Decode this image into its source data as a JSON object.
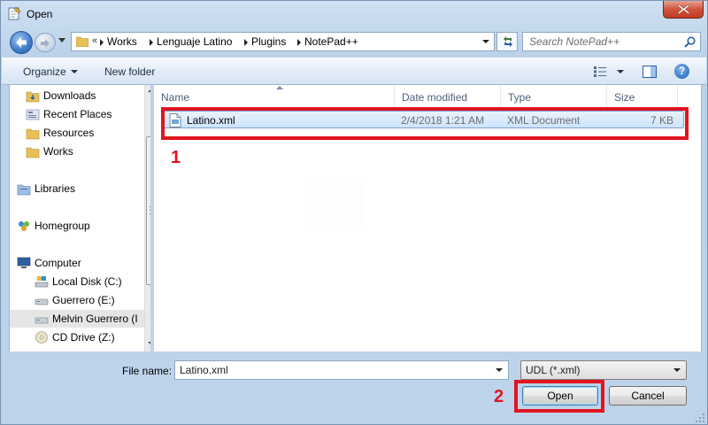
{
  "window": {
    "title": "Open"
  },
  "address": {
    "overflow": "«",
    "crumbs": [
      "Works",
      "Lenguaje Latino",
      "Plugins",
      "NotePad++"
    ]
  },
  "search": {
    "placeholder": "Search NotePad++"
  },
  "toolbar": {
    "organize": "Organize",
    "new_folder": "New folder",
    "help": "?"
  },
  "nav": {
    "items": [
      {
        "label": "Downloads",
        "icon": "downloads-folder-icon"
      },
      {
        "label": "Recent Places",
        "icon": "recent-places-icon"
      },
      {
        "label": "Resources",
        "icon": "folder-icon"
      },
      {
        "label": "Works",
        "icon": "folder-icon"
      },
      {
        "label": "Libraries",
        "icon": "libraries-icon"
      },
      {
        "label": "Homegroup",
        "icon": "homegroup-icon"
      },
      {
        "label": "Computer",
        "icon": "computer-icon"
      },
      {
        "label": "Local Disk (C:)",
        "icon": "local-disk-icon"
      },
      {
        "label": "Guerrero (E:)",
        "icon": "drive-icon"
      },
      {
        "label": "Melvin Guerrero (I",
        "icon": "drive-icon",
        "selected": true
      },
      {
        "label": "CD Drive (Z:)",
        "icon": "cd-drive-icon"
      }
    ]
  },
  "filelist": {
    "columns": [
      "Name",
      "Date modified",
      "Type",
      "Size"
    ],
    "rows": [
      {
        "name": "Latino.xml",
        "date": "2/4/2018 1:21 AM",
        "type": "XML Document",
        "size": "7 KB",
        "selected": true
      }
    ]
  },
  "bottom": {
    "file_name_label": "File name:",
    "file_name_value": "Latino.xml",
    "file_type": "UDL (*.xml)",
    "open_label": "Open",
    "cancel_label": "Cancel"
  },
  "annotations": {
    "step1": "1",
    "step2": "2",
    "color": "#e0151f"
  }
}
